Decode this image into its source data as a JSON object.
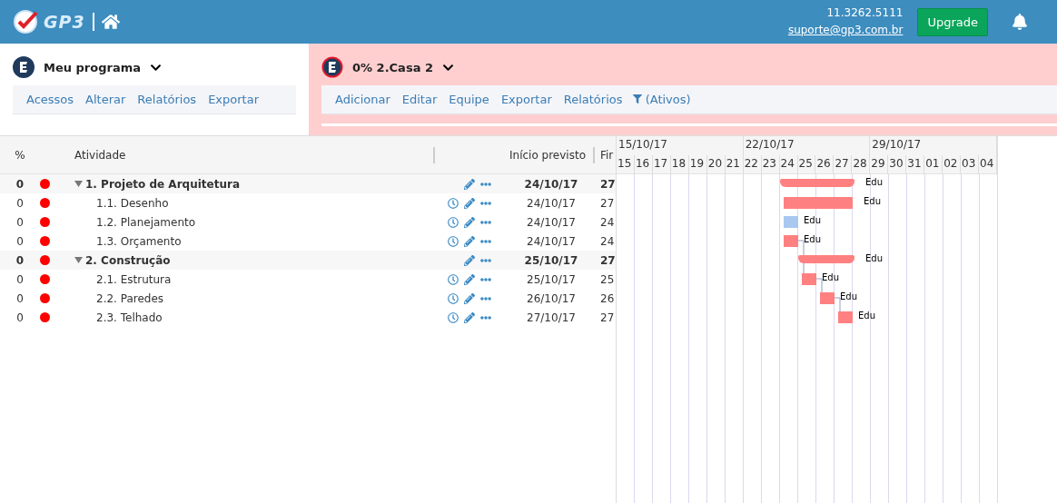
{
  "header": {
    "logo_text": "GP3",
    "phone": "11.3262.5111",
    "email": "suporte@gp3.com.br",
    "upgrade": "Upgrade"
  },
  "program": {
    "title": "Meu programa",
    "menu": [
      "Acessos",
      "Alterar",
      "Relatórios",
      "Exportar"
    ]
  },
  "project": {
    "title": "0% 2.Casa 2",
    "flagged": true,
    "menu": [
      "Adicionar",
      "Editar",
      "Equipe",
      "Exportar",
      "Relatórios"
    ],
    "filter": "(Ativos)"
  },
  "table": {
    "columns": [
      "%",
      "Atividade",
      "Início previsto",
      "Fir"
    ],
    "rows": [
      {
        "pct": "0",
        "name": "1. Projeto de Arquitetura",
        "kind": "group",
        "expanded": true,
        "start": "24/10/17",
        "end": "27",
        "bar": {
          "color": "#ff8080",
          "label": "Edu",
          "link": false
        }
      },
      {
        "pct": "0",
        "name": "1.1. Desenho",
        "kind": "task",
        "start": "24/10/17",
        "end": "27",
        "bar": {
          "color": "#ff8080",
          "label": "Edu",
          "link": false
        }
      },
      {
        "pct": "0",
        "name": "1.2. Planejamento",
        "kind": "task",
        "start": "24/10/17",
        "end": "24",
        "bar": {
          "color": "#a8c8f0",
          "label": "Edu",
          "link": false
        }
      },
      {
        "pct": "0",
        "name": "1.3. Orçamento",
        "kind": "task",
        "start": "24/10/17",
        "end": "24",
        "bar": {
          "color": "#ff8080",
          "label": "Edu",
          "link": true
        }
      },
      {
        "pct": "0",
        "name": "2. Construção",
        "kind": "group",
        "expanded": true,
        "start": "25/10/17",
        "end": "27",
        "bar": {
          "color": "#ff8080",
          "label": "Edu",
          "link": false
        }
      },
      {
        "pct": "0",
        "name": "2.1. Estrutura",
        "kind": "task",
        "start": "25/10/17",
        "end": "25",
        "bar": {
          "color": "#ff8080",
          "label": "Edu",
          "link": true
        }
      },
      {
        "pct": "0",
        "name": "2.2. Paredes",
        "kind": "task",
        "start": "26/10/17",
        "end": "26",
        "bar": {
          "color": "#ff8080",
          "label": "Edu",
          "link": true
        }
      },
      {
        "pct": "0",
        "name": "2.3. Telhado",
        "kind": "task",
        "start": "27/10/17",
        "end": "27",
        "bar": {
          "color": "#ff8080",
          "label": "Edu",
          "link": false
        }
      }
    ]
  },
  "gantt": {
    "weeks": [
      "15/10/17",
      "22/10/17",
      "29/10/17"
    ],
    "days": [
      "15",
      "16",
      "17",
      "18",
      "19",
      "20",
      "21",
      "22",
      "23",
      "24",
      "25",
      "26",
      "27",
      "28",
      "29",
      "30",
      "31",
      "01",
      "02",
      "03",
      "04"
    ]
  }
}
